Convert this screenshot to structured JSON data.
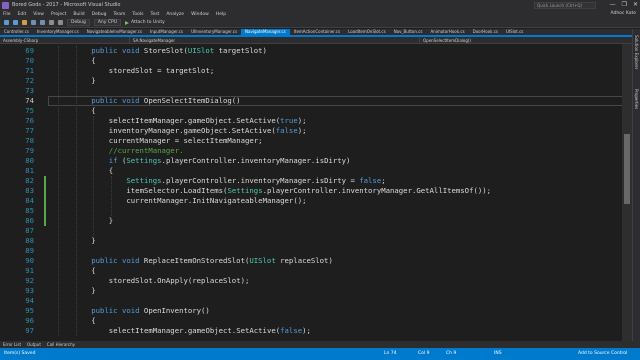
{
  "window": {
    "title": "Bored Gods - 2017 - Microsoft Visual Studio",
    "quick_launch": "Quick Launch (Ctrl+Q)",
    "controls": [
      "—",
      "❐",
      "✕"
    ]
  },
  "menu": {
    "items": [
      "File",
      "Edit",
      "View",
      "Project",
      "Build",
      "Debug",
      "Team",
      "Tools",
      "Test",
      "Analyze",
      "Window",
      "Help"
    ],
    "user": "Adhoc Kate"
  },
  "toolbar": {
    "config": "Debug",
    "platform": "Any CPU",
    "attach": "Attach to Unity"
  },
  "tabs": [
    {
      "label": "Controller.cs",
      "active": false
    },
    {
      "label": "InventoryManager.cs",
      "active": false
    },
    {
      "label": "NavigateableInvManager.cs",
      "active": false
    },
    {
      "label": "InputManager.cs",
      "active": false
    },
    {
      "label": "UIInventoryManager.cs",
      "active": false
    },
    {
      "label": "NavigateManager.cs",
      "active": true
    },
    {
      "label": "ItemActionContainer.cs",
      "active": false
    },
    {
      "label": "LoadItemOnSlot.cs",
      "active": false
    },
    {
      "label": "Nav_Button.cs",
      "active": false
    },
    {
      "label": "AnimatorHook.cs",
      "active": false
    },
    {
      "label": "DoorHook.cs",
      "active": false
    },
    {
      "label": "UISlot.cs",
      "active": false
    }
  ],
  "navbar": {
    "project": "Assembly-CSharp",
    "type": "SA.NavigateManager",
    "member": "OpenSelectItemDialog()"
  },
  "side_panels": [
    "Solution Explorer",
    "Properties"
  ],
  "code": {
    "current_line": 74,
    "lines": [
      {
        "n": 69,
        "indent": 2,
        "tokens": [
          [
            "k",
            "public "
          ],
          [
            "k",
            "void "
          ],
          [
            "",
            "StoreSlot("
          ],
          [
            "t",
            "UISlot "
          ],
          [
            "",
            "targetSlot)"
          ]
        ]
      },
      {
        "n": 70,
        "indent": 2,
        "tokens": [
          [
            "",
            "{"
          ]
        ]
      },
      {
        "n": 71,
        "indent": 3,
        "tokens": [
          [
            "",
            "storedSlot = targetSlot;"
          ]
        ]
      },
      {
        "n": 72,
        "indent": 2,
        "tokens": [
          [
            "",
            "}"
          ]
        ]
      },
      {
        "n": 73,
        "indent": 0,
        "tokens": []
      },
      {
        "n": 74,
        "indent": 2,
        "tokens": [
          [
            "k",
            "public "
          ],
          [
            "k",
            "void "
          ],
          [
            "",
            "OpenSelectItemDialog()"
          ]
        ]
      },
      {
        "n": 75,
        "indent": 2,
        "tokens": [
          [
            "",
            "{"
          ]
        ]
      },
      {
        "n": 76,
        "indent": 3,
        "tokens": [
          [
            "",
            "selectItemManager.gameObject.SetActive("
          ],
          [
            "k",
            "true"
          ],
          [
            "",
            ");"
          ]
        ]
      },
      {
        "n": 77,
        "indent": 3,
        "tokens": [
          [
            "",
            "inventoryManager.gameObject.SetActive("
          ],
          [
            "k",
            "false"
          ],
          [
            "",
            ");"
          ]
        ]
      },
      {
        "n": 78,
        "indent": 3,
        "tokens": [
          [
            "",
            "currentManager = selectItemManager;"
          ]
        ]
      },
      {
        "n": 79,
        "indent": 3,
        "tokens": [
          [
            "c",
            "//currentManager."
          ]
        ]
      },
      {
        "n": 80,
        "indent": 3,
        "tokens": [
          [
            "k",
            "if "
          ],
          [
            "",
            "("
          ],
          [
            "t",
            "Settings"
          ],
          [
            "",
            ".playerController.inventoryManager.isDirty)"
          ]
        ]
      },
      {
        "n": 81,
        "indent": 3,
        "tokens": [
          [
            "",
            "{"
          ]
        ]
      },
      {
        "n": 82,
        "indent": 4,
        "tokens": [
          [
            "t",
            "Settings"
          ],
          [
            "",
            ".playerController.inventoryManager.isDirty = "
          ],
          [
            "k",
            "false"
          ],
          [
            "",
            ";"
          ]
        ]
      },
      {
        "n": 83,
        "indent": 4,
        "tokens": [
          [
            "",
            "itemSelector.LoadItems("
          ],
          [
            "t",
            "Settings"
          ],
          [
            "",
            ".playerController.inventoryManager.GetAllItemsOf());"
          ]
        ]
      },
      {
        "n": 84,
        "indent": 4,
        "tokens": [
          [
            "",
            "currentManager.InitNavigateableManager();"
          ]
        ]
      },
      {
        "n": 85,
        "indent": 0,
        "tokens": []
      },
      {
        "n": 86,
        "indent": 3,
        "tokens": [
          [
            "",
            "}"
          ]
        ]
      },
      {
        "n": 87,
        "indent": 0,
        "tokens": []
      },
      {
        "n": 88,
        "indent": 2,
        "tokens": [
          [
            "",
            "}"
          ]
        ]
      },
      {
        "n": 89,
        "indent": 0,
        "tokens": []
      },
      {
        "n": 90,
        "indent": 2,
        "tokens": [
          [
            "k",
            "public "
          ],
          [
            "k",
            "void "
          ],
          [
            "",
            "ReplaceItemOnStoredSlot("
          ],
          [
            "t",
            "UISlot "
          ],
          [
            "",
            "replaceSlot)"
          ]
        ]
      },
      {
        "n": 91,
        "indent": 2,
        "tokens": [
          [
            "",
            "{"
          ]
        ]
      },
      {
        "n": 92,
        "indent": 3,
        "tokens": [
          [
            "",
            "storedSlot.OnApply(replaceSlot);"
          ]
        ]
      },
      {
        "n": 93,
        "indent": 2,
        "tokens": [
          [
            "",
            "}"
          ]
        ]
      },
      {
        "n": 94,
        "indent": 0,
        "tokens": []
      },
      {
        "n": 95,
        "indent": 2,
        "tokens": [
          [
            "k",
            "public "
          ],
          [
            "k",
            "void "
          ],
          [
            "",
            "OpenInventory()"
          ]
        ]
      },
      {
        "n": 96,
        "indent": 2,
        "tokens": [
          [
            "",
            "{"
          ]
        ]
      },
      {
        "n": 97,
        "indent": 3,
        "tokens": [
          [
            "",
            "selectItemManager.gameObject.SetActive("
          ],
          [
            "k",
            "false"
          ],
          [
            "",
            ");"
          ]
        ]
      }
    ]
  },
  "bottom_tabs": [
    "Error List",
    "Output",
    "Call Hierarchy"
  ],
  "status": {
    "left": "Item(s) Saved",
    "ln": "Ln 74",
    "col": "Col 9",
    "ch": "Ch 9",
    "ins": "INS",
    "source_control": "Add to Source Control"
  },
  "colors": {
    "accent": "#007acc",
    "keyword": "#569cd6",
    "type": "#4ec9b0",
    "comment": "#57a64a",
    "linenumber": "#2b91af"
  }
}
